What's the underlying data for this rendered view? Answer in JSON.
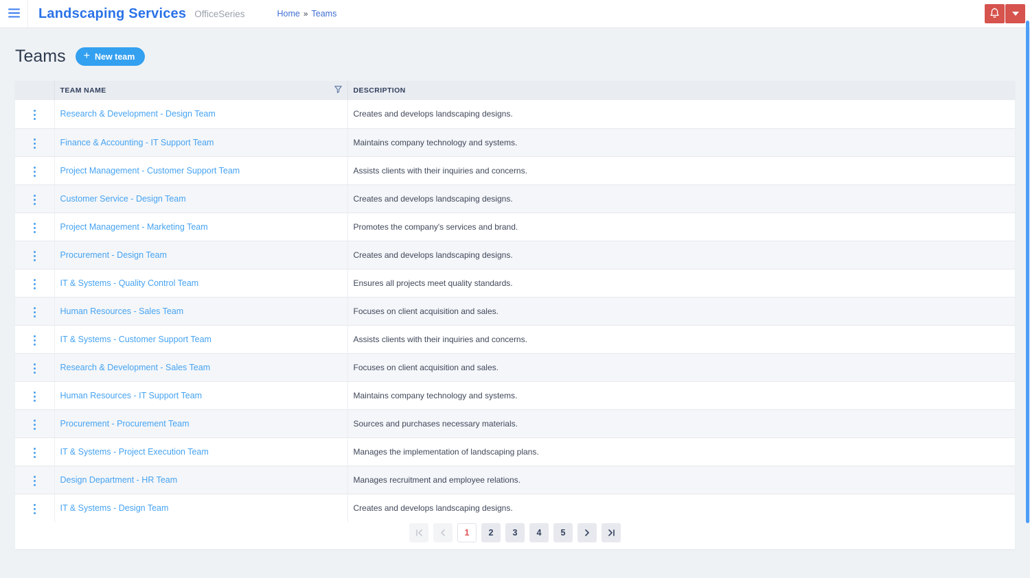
{
  "header": {
    "app_title": "Landscaping Services",
    "app_subtitle": "OfficeSeries",
    "breadcrumb": {
      "home": "Home",
      "separator": "»",
      "current": "Teams"
    }
  },
  "page": {
    "title": "Teams",
    "new_team_button": {
      "plus": "+",
      "label": "New team"
    }
  },
  "table": {
    "columns": {
      "team_name": "TEAM NAME",
      "description": "DESCRIPTION"
    },
    "rows": [
      {
        "name": "Research & Development - Design Team",
        "description": "Creates and develops landscaping designs."
      },
      {
        "name": "Finance & Accounting - IT Support Team",
        "description": "Maintains company technology and systems."
      },
      {
        "name": "Project Management - Customer Support Team",
        "description": "Assists clients with their inquiries and concerns."
      },
      {
        "name": "Customer Service - Design Team",
        "description": "Creates and develops landscaping designs."
      },
      {
        "name": "Project Management - Marketing Team",
        "description": "Promotes the company's services and brand."
      },
      {
        "name": "Procurement - Design Team",
        "description": "Creates and develops landscaping designs."
      },
      {
        "name": "IT & Systems - Quality Control Team",
        "description": "Ensures all projects meet quality standards."
      },
      {
        "name": "Human Resources - Sales Team",
        "description": "Focuses on client acquisition and sales."
      },
      {
        "name": "IT & Systems - Customer Support Team",
        "description": "Assists clients with their inquiries and concerns."
      },
      {
        "name": "Research & Development - Sales Team",
        "description": "Focuses on client acquisition and sales."
      },
      {
        "name": "Human Resources - IT Support Team",
        "description": "Maintains company technology and systems."
      },
      {
        "name": "Procurement - Procurement Team",
        "description": "Sources and purchases necessary materials."
      },
      {
        "name": "IT & Systems - Project Execution Team",
        "description": "Manages the implementation of landscaping plans."
      },
      {
        "name": "Design Department - HR Team",
        "description": "Manages recruitment and employee relations."
      },
      {
        "name": "IT & Systems - Design Team",
        "description": "Creates and develops landscaping designs."
      }
    ]
  },
  "pagination": {
    "pages": [
      "1",
      "2",
      "3",
      "4",
      "5"
    ],
    "current_page": "1"
  },
  "icons": {
    "menu": "hamburger-icon",
    "notifications": "bell-icon",
    "account_dropdown": "chevron-down-icon",
    "filter": "funnel-icon",
    "row_menu": "kebab-icon"
  },
  "colors": {
    "brand_blue": "#2a72e8",
    "accent_blue": "#34a0f0",
    "link_blue": "#46a3f2",
    "alert_red": "#d6534e",
    "current_page_red": "#e05050",
    "scrollbar_blue": "#4d9ef7",
    "header_row_bg": "#e9ecf1",
    "stripe_bg": "#f4f6f9",
    "page_bg": "#eff2f5"
  }
}
